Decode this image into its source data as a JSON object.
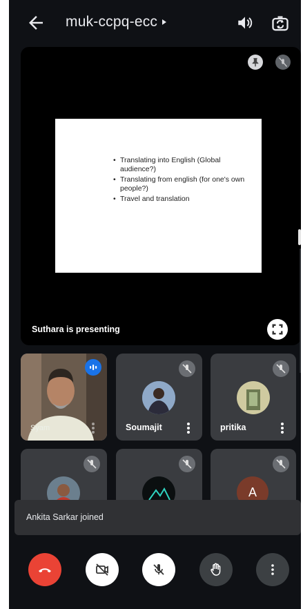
{
  "app": {
    "meeting_code": "muk-ccpq-ecc"
  },
  "presentation": {
    "bullets": [
      "Translating into English (Global audience?)",
      "Translating from english (for one's own people?)",
      "Travel and translation"
    ],
    "status": "Suthara is presenting"
  },
  "participants": [
    {
      "name": "Syam",
      "speaking": true
    },
    {
      "name": "Soumajit"
    },
    {
      "name": "pritika"
    },
    {
      "name": ""
    },
    {
      "name": ""
    },
    {
      "name": "",
      "initial": "A"
    }
  ],
  "notification": {
    "text": "Ankita Sarkar joined"
  },
  "colors": {
    "end_call": "#ea4335",
    "speaking_accent": "#1a73e8",
    "letter_avatar": "#7a3b2a"
  },
  "icons": [
    "back-arrow-icon",
    "speaker-icon",
    "switch-camera-icon",
    "pin-icon",
    "mic-off-icon",
    "fullscreen-icon",
    "more-vert-icon",
    "end-call-icon",
    "camera-off-icon",
    "raise-hand-icon"
  ]
}
